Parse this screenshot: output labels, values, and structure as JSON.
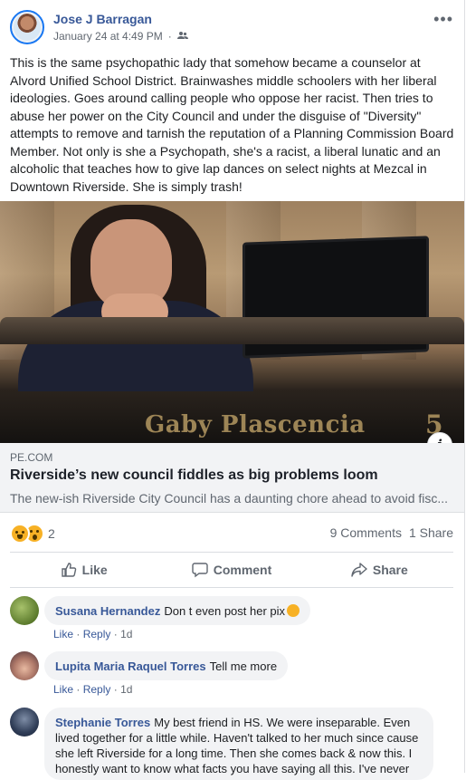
{
  "post": {
    "author": "Jose J Barragan",
    "timestamp": "January 24 at 4:49 PM",
    "separator": "·",
    "more_label": "•••",
    "text": "This is the same psychopathic lady that somehow became a counselor at Alvord Unified School District. Brainwashes middle schoolers with her liberal ideologies. Goes around calling people who oppose her racist. Then tries to abuse her power on the City Council and under the disguise of \"Diversity\" attempts to remove and tarnish the reputation of a Planning Commission Board Member. Not only is she a Psychopath, she's a racist, a liberal lunatic and an alcoholic that teaches how to give lap dances on select nights at Mezcal in Downtown Riverside. She is simply trash!",
    "icons": {
      "audience": "friends-icon",
      "menu": "more-icon"
    }
  },
  "image": {
    "nameplate": "Gaby Plascencia",
    "seat_number": "5",
    "info_label": "i"
  },
  "link_preview": {
    "domain": "PE.COM",
    "title": "Riverside’s new council fiddles as big problems loom",
    "description": "The new-ish Riverside City Council has a daunting chore ahead to avoid fisc..."
  },
  "reactions": {
    "types": [
      "haha",
      "wow"
    ],
    "count": "2",
    "comments": "9 Comments",
    "shares": "1 Share"
  },
  "actions": {
    "like": "Like",
    "comment": "Comment",
    "share": "Share"
  },
  "comments": [
    {
      "name": "Susana Hernandez",
      "text": "Don t even post her pix",
      "like": "Like",
      "reply": "Reply",
      "dot": "·",
      "time": "1d"
    },
    {
      "name": "Lupita Maria Raquel Torres",
      "text": "Tell me more",
      "like": "Like",
      "reply": "Reply",
      "dot": "·",
      "time": "1d"
    },
    {
      "name": "Stephanie Torres",
      "text": "My best friend in HS. We were inseparable. Even lived together for a little while. Haven't talked to her much since cause she left Riverside for a long time. Then she comes back & now this. I honestly want to know what facts you have saying all this. I've never"
    }
  ],
  "colors": {
    "link_blue": "#385898",
    "text_gray": "#606770",
    "reaction_yellow": "#f7b125",
    "bubble_bg": "#f2f3f5"
  }
}
